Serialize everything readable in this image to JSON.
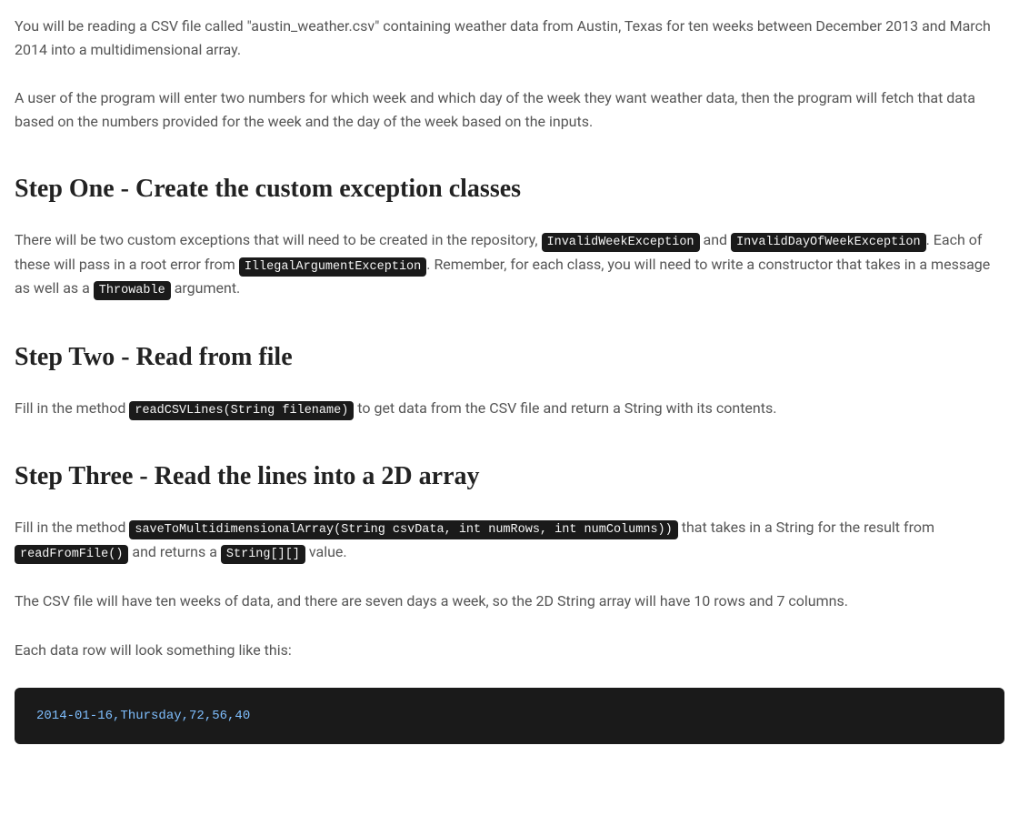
{
  "intro": {
    "p1": "You will be reading a CSV file called \"austin_weather.csv\" containing weather data from Austin, Texas for ten weeks between December 2013 and March 2014 into a multidimensional array.",
    "p2": "A user of the program will enter two numbers for which week and which day of the week they want weather data, then the program will fetch that data based on the numbers provided for the week and the day of the week based on the inputs."
  },
  "step1": {
    "heading": "Step One - Create the custom exception classes",
    "text_before_code1": "There will be two custom exceptions that will need to be created in the repository, ",
    "code1": "InvalidWeekException",
    "text_between_code1_code2": " and ",
    "code2": "InvalidDayOfWeekException",
    "text_between_code2_code3": ". Each of these will pass in a root error from ",
    "code3": "IllegalArgumentException",
    "text_between_code3_code4": ". Remember, for each class, you will need to write a constructor that takes in a message as well as a ",
    "code4": "Throwable",
    "text_after_code4": " argument."
  },
  "step2": {
    "heading": "Step Two - Read from file",
    "text_before_code1": "Fill in the method ",
    "code1": "readCSVLines(String filename)",
    "text_after_code1": " to get data from the CSV file and return a String with its contents."
  },
  "step3": {
    "heading": "Step Three - Read the lines into a 2D array",
    "p1_before_code1": "Fill in the method ",
    "p1_code1": "saveToMultidimensionalArray(String csvData, int numRows, int numColumns))",
    "p1_between_code1_code2": " that takes in a String for the result from ",
    "p1_code2": "readFromFile()",
    "p1_between_code2_code3": " and returns a ",
    "p1_code3": "String[][]",
    "p1_after_code3": " value.",
    "p2": "The CSV file will have ten weeks of data, and there are seven days a week, so the 2D String array will have 10 rows and 7 columns.",
    "p3": "Each data row will look something like this:",
    "code_block": "2014-01-16,Thursday,72,56,40"
  }
}
